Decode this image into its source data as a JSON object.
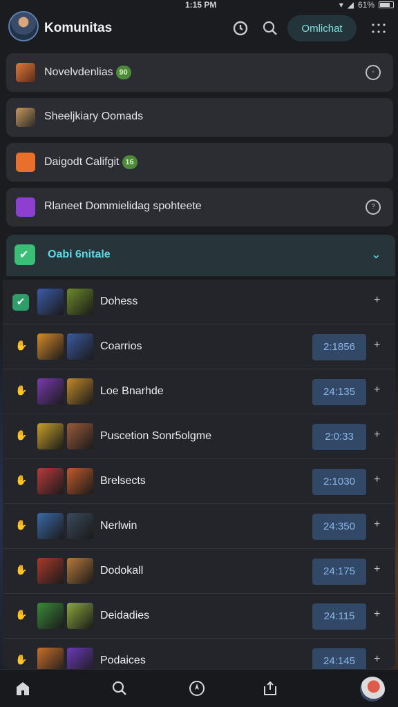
{
  "status": {
    "time": "1:15 PM",
    "battery": "61%"
  },
  "header": {
    "title": "Komunitas",
    "action_button": "Omlichat"
  },
  "cards": [
    {
      "label": "Novelvdenlias",
      "badge": "90",
      "color": "#b8552a"
    },
    {
      "label": "Sheeljkiary Oomads",
      "badge": "",
      "color": "#8a6a3a"
    },
    {
      "label": "Daigodt Califgit",
      "badge": "16",
      "color": "#e8702a"
    },
    {
      "label": "Rlaneet Dommielidag spohteete",
      "badge": "",
      "color": "#8e3fd0"
    }
  ],
  "group": {
    "label": "Oabi 6nitale"
  },
  "rows": [
    {
      "name": "Dohess",
      "score": "",
      "c1": "#3b5ba8",
      "c2": "#6b8a2a",
      "selected": true
    },
    {
      "name": "Coarrios",
      "score": "2:1856",
      "c1": "#d68a2a",
      "c2": "#3a5aa0",
      "selected": false
    },
    {
      "name": "Loe Bnarhde",
      "score": "24:135",
      "c1": "#7a3ab0",
      "c2": "#c28a2a",
      "selected": false
    },
    {
      "name": "Puscetion Sonr5olgme",
      "score": "2:0:33",
      "c1": "#c8a02a",
      "c2": "#9a5a3a",
      "selected": false
    },
    {
      "name": "Brelsects",
      "score": "2:1030",
      "c1": "#b83a3a",
      "c2": "#c25a2a",
      "selected": false
    },
    {
      "name": "Nerlwin",
      "score": "24:350",
      "c1": "#3a6aa8",
      "c2": "#3a4a5a",
      "selected": false
    },
    {
      "name": "Dodokall",
      "score": "24:175",
      "c1": "#a83a2a",
      "c2": "#b87a3a",
      "selected": false
    },
    {
      "name": "Deidadies",
      "score": "24:115",
      "c1": "#3a8a3a",
      "c2": "#8aa83a",
      "selected": false
    },
    {
      "name": "Podaices",
      "score": "24:145",
      "c1": "#c8702a",
      "c2": "#6a3ab8",
      "selected": false
    }
  ]
}
